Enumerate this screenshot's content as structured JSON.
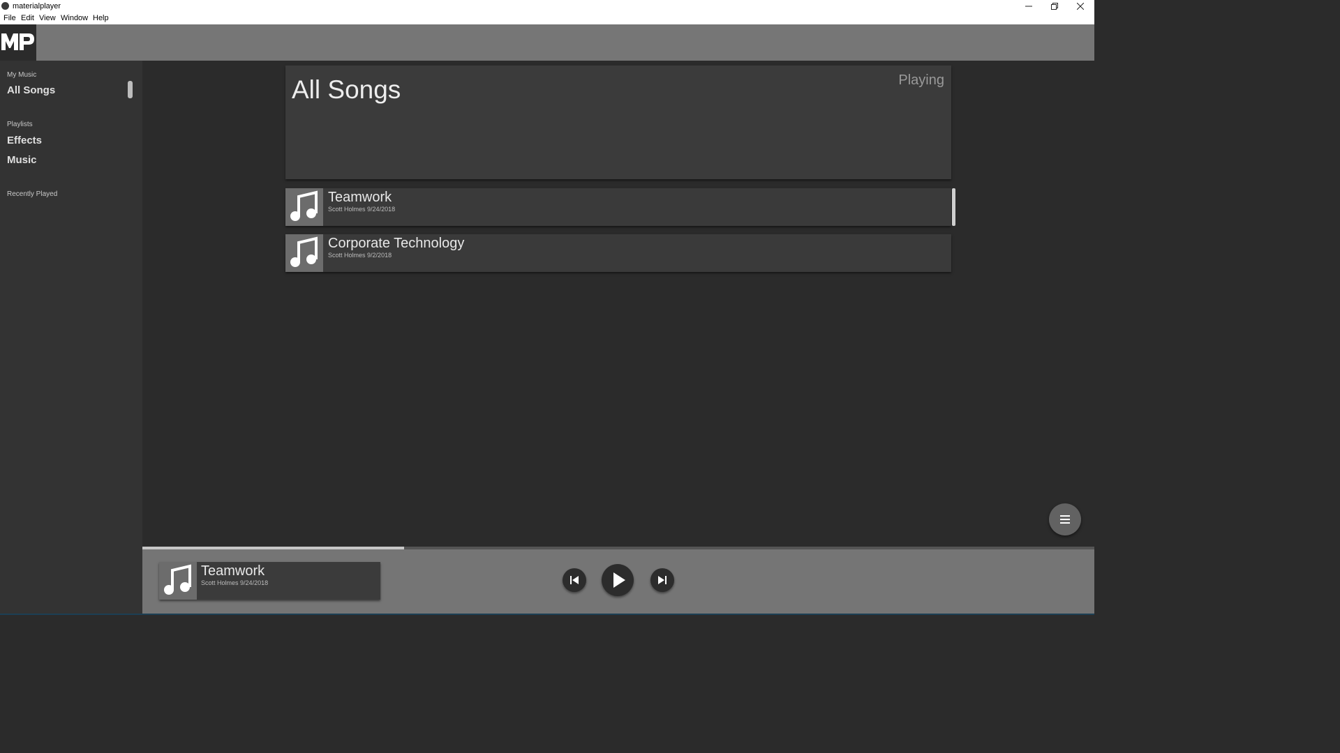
{
  "window": {
    "title": "materialplayer",
    "controls": [
      "minimize",
      "restore",
      "close"
    ]
  },
  "menubar": {
    "items": [
      "File",
      "Edit",
      "View",
      "Window",
      "Help"
    ]
  },
  "logo": {
    "text": "MP"
  },
  "sidebar": {
    "sections": [
      {
        "label": "My Music",
        "items": [
          "All Songs"
        ]
      },
      {
        "label": "Playlists",
        "items": [
          "Effects",
          "Music"
        ]
      },
      {
        "label": "Recently Played",
        "items": []
      }
    ]
  },
  "main": {
    "title": "All Songs",
    "status": "Playing",
    "songs": [
      {
        "title": "Teamwork",
        "artist": "Scott Holmes",
        "date": "9/24/2018"
      },
      {
        "title": "Corporate Technology",
        "artist": "Scott Holmes",
        "date": "9/2/2018"
      }
    ]
  },
  "player": {
    "now_playing": {
      "title": "Teamwork",
      "artist": "Scott Holmes",
      "date": "9/24/2018"
    },
    "progress": 0.275,
    "controls": [
      "previous",
      "play",
      "next"
    ]
  },
  "colors": {
    "background": "#2b2b2b",
    "sidebar": "#333333",
    "card": "#3b3b3b",
    "topbar": "#767676",
    "accent_text": "#e8e8e8"
  }
}
